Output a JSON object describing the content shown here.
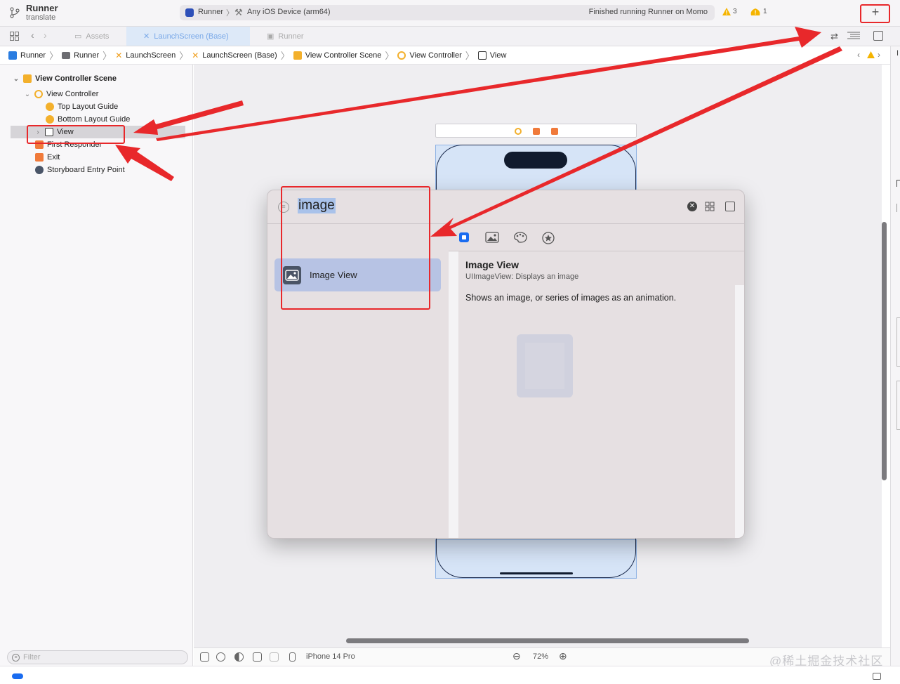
{
  "toolbar": {
    "project_name": "Runner",
    "branch": "translate",
    "scheme": "Runner",
    "destination": "Any iOS Device (arm64)",
    "status": "Finished running Runner on Momo",
    "warnings": "3",
    "issues": "1",
    "add_label": "+"
  },
  "tabs": [
    {
      "label": "Assets"
    },
    {
      "label": "LaunchScreen (Base)"
    },
    {
      "label": "Runner"
    }
  ],
  "breadcrumb": [
    "Runner",
    "Runner",
    "LaunchScreen",
    "LaunchScreen (Base)",
    "View Controller Scene",
    "View Controller",
    "View"
  ],
  "navigator": {
    "items": [
      {
        "label": "View Controller Scene"
      },
      {
        "label": "View Controller"
      },
      {
        "label": "Top Layout Guide"
      },
      {
        "label": "Bottom Layout Guide"
      },
      {
        "label": "View"
      },
      {
        "label": "First Responder"
      },
      {
        "label": "Exit"
      },
      {
        "label": "Storyboard Entry Point"
      }
    ],
    "filter_placeholder": "Filter"
  },
  "library": {
    "search_value": "image",
    "results": [
      {
        "label": "Image View"
      }
    ],
    "detail": {
      "title": "Image View",
      "subtitle": "UIImageView: Displays an image",
      "description": "Shows an image, or series of images as an animation."
    }
  },
  "bottom_bar": {
    "device": "iPhone 14 Pro",
    "zoom": "72%"
  },
  "watermark": "@稀土掘金技术社区",
  "colors": {
    "accent": "#1a6cf0",
    "annotation": "#e8282b",
    "selection": "#b7c3e4"
  }
}
